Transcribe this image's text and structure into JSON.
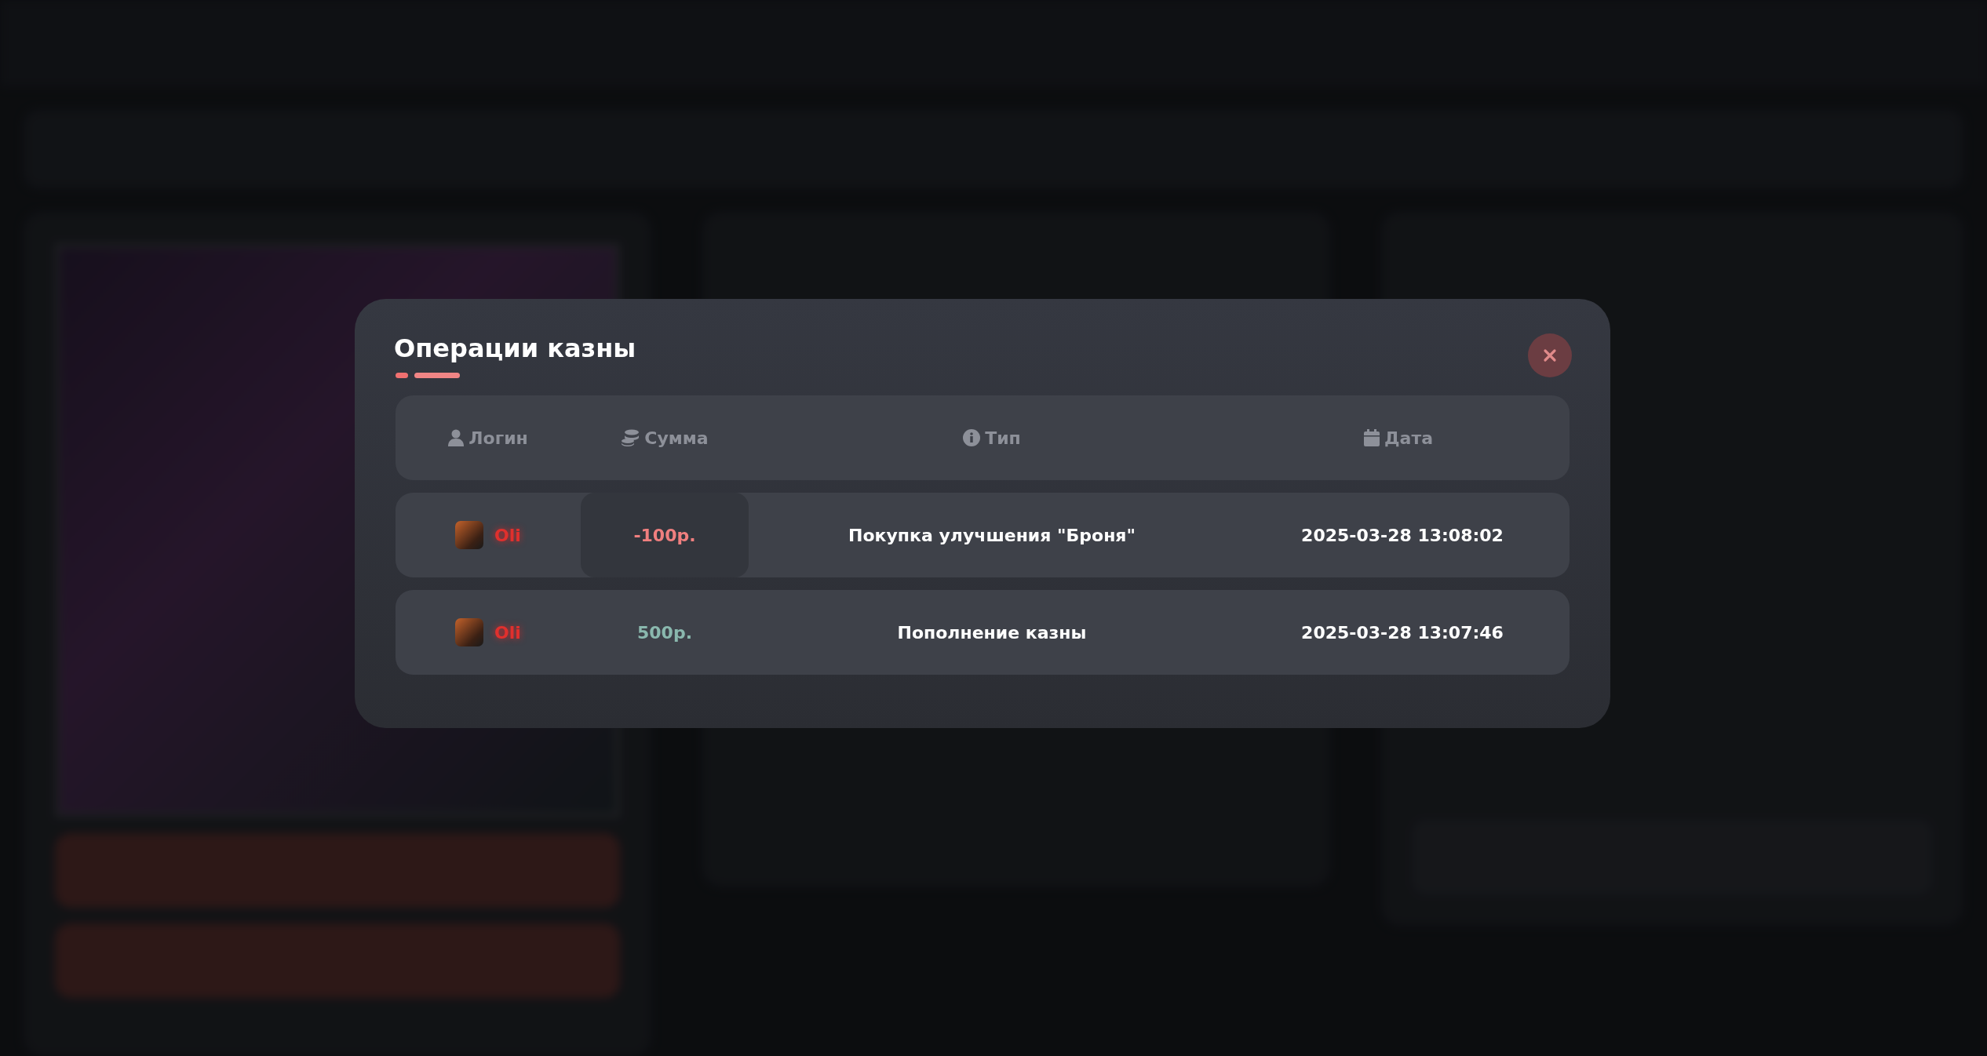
{
  "modal": {
    "title": "Операции казны",
    "columns": [
      {
        "kind": "user",
        "label": "Логин"
      },
      {
        "kind": "coins",
        "label": "Сумма"
      },
      {
        "kind": "info",
        "label": "Тип"
      },
      {
        "kind": "calendar",
        "label": "Дата"
      }
    ],
    "rows": [
      {
        "login": "Oli",
        "amount": {
          "text": "-100р.",
          "kind": "debit",
          "hovered": true
        },
        "type": "Покупка улучшения \"Броня\"",
        "date": "2025-03-28 13:08:02"
      },
      {
        "login": "Oli",
        "amount": {
          "text": "500р.",
          "kind": "credit",
          "hovered": false
        },
        "type": "Пополнение казны",
        "date": "2025-03-28 13:07:46"
      }
    ]
  }
}
